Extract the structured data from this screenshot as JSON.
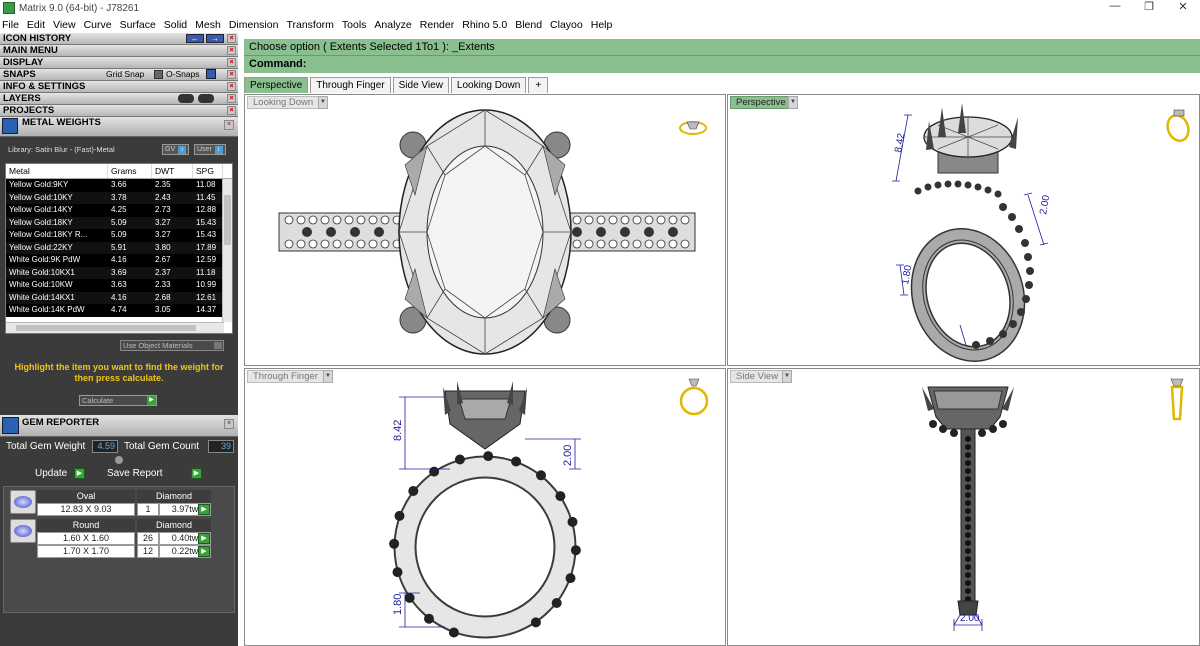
{
  "window": {
    "title": "Matrix 9.0 (64-bit) - J78261",
    "controls": [
      "—",
      "❐",
      "✕"
    ]
  },
  "menu": [
    "File",
    "Edit",
    "View",
    "Curve",
    "Surface",
    "Solid",
    "Mesh",
    "Dimension",
    "Transform",
    "Tools",
    "Analyze",
    "Render",
    "Rhino 5.0",
    "Blend",
    "Clayoo",
    "Help"
  ],
  "left": {
    "sections": [
      "ICON HISTORY",
      "MAIN MENU",
      "DISPLAY",
      "SNAPS",
      "INFO & SETTINGS",
      "LAYERS",
      "PROJECTS"
    ],
    "snaps": {
      "grid": "Grid Snap",
      "osnaps": "O-Snaps"
    },
    "metal_weights": {
      "title": "METAL WEIGHTS",
      "library": "Library: Satin Blur - (Fast)-Metal",
      "gv": "GV",
      "user": "User",
      "columns": [
        "Metal",
        "Grams",
        "DWT",
        "SPG"
      ],
      "rows": [
        [
          "Yellow Gold:9KY",
          "3.66",
          "2.35",
          "11.08"
        ],
        [
          "Yellow Gold:10KY",
          "3.78",
          "2.43",
          "11.45"
        ],
        [
          "Yellow Gold:14KY",
          "4.25",
          "2.73",
          "12.88"
        ],
        [
          "Yellow Gold:18KY",
          "5.09",
          "3.27",
          "15.43"
        ],
        [
          "Yellow Gold:18KY R...",
          "5.09",
          "3.27",
          "15.43"
        ],
        [
          "Yellow Gold:22KY",
          "5.91",
          "3.80",
          "17.89"
        ],
        [
          "White Gold:9K PdW",
          "4.16",
          "2.67",
          "12.59"
        ],
        [
          "White Gold:10KX1",
          "3.69",
          "2.37",
          "11.18"
        ],
        [
          "White Gold:10KW",
          "3.63",
          "2.33",
          "10.99"
        ],
        [
          "White Gold:14KX1",
          "4.16",
          "2.68",
          "12.61"
        ],
        [
          "White Gold:14K PdW",
          "4.74",
          "3.05",
          "14.37"
        ]
      ],
      "use_object": "Use Object Materials",
      "hint": "Highlight the item you want to find the weight for then press calculate.",
      "calculate": "Calculate"
    },
    "gem_reporter": {
      "title": "GEM REPORTER",
      "total_weight_label": "Total Gem Weight",
      "total_weight": "4.59",
      "total_count_label": "Total Gem Count",
      "total_count": "39",
      "update": "Update",
      "save_report": "Save Report",
      "groups": [
        {
          "shape": "Oval",
          "material": "Diamond",
          "rows": [
            [
              "12.83 X 9.03",
              "1",
              "3.97tw"
            ]
          ]
        },
        {
          "shape": "Round",
          "material": "Diamond",
          "rows": [
            [
              "1.60 X 1.60",
              "26",
              "0.40tw"
            ],
            [
              "1.70 X 1.70",
              "12",
              "0.22tw"
            ]
          ]
        }
      ]
    }
  },
  "command": {
    "line1": "Choose option ( Extents  Selected  1To1 ): _Extents",
    "line2": "Command:"
  },
  "tabs": [
    "Perspective",
    "Through Finger",
    "Side View",
    "Looking Down",
    "+"
  ],
  "viewports": {
    "looking_down": "Looking Down",
    "perspective": "Perspective",
    "through_finger": "Through Finger",
    "side_view": "Side View"
  },
  "dims": {
    "d842": "8.42",
    "d200": "2.00",
    "d180": "1.80"
  },
  "colors": {
    "accent_green": "#8ac08f",
    "hint_yellow": "#f0c419",
    "panel_dark": "#3b3b3b"
  }
}
